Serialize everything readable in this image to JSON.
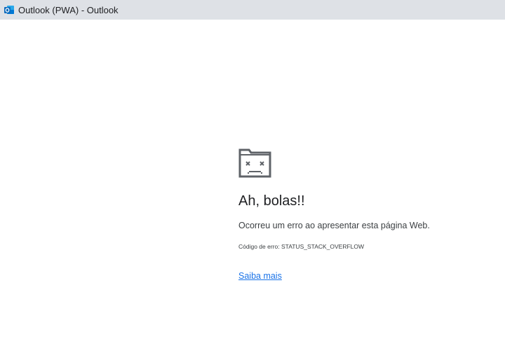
{
  "window": {
    "title": "Outlook (PWA) - Outlook",
    "app_icon": "outlook-icon"
  },
  "error_page": {
    "icon": "sad-folder-icon",
    "heading": "Ah, bolas!!",
    "message": "Ocorreu um erro ao apresentar esta página Web.",
    "code_label": "Código de erro:",
    "code_value": "STATUS_STACK_OVERFLOW",
    "learn_more": "Saiba mais"
  },
  "colors": {
    "titlebar": "#dee1e6",
    "link": "#1a73e8",
    "outlook_brand": "#0f6cbd"
  }
}
